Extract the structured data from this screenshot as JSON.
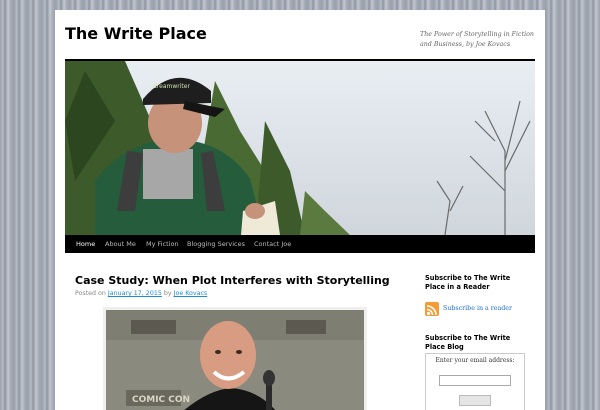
{
  "site": {
    "title": "The Write Place",
    "description": "The Power of Storytelling in Fiction and Business, by Joe Kovacs"
  },
  "nav": {
    "items": [
      {
        "label": "Home",
        "active": true
      },
      {
        "label": "About Me",
        "active": false
      },
      {
        "label": "My Fiction",
        "active": false
      },
      {
        "label": "Blogging Services",
        "active": false
      },
      {
        "label": "Contact Joe",
        "active": false
      }
    ]
  },
  "banner": {
    "cap_text": "dreamwriter"
  },
  "post": {
    "title": "Case Study: When Plot Interferes with Storytelling",
    "meta_prefix": "Posted on",
    "date": "January 17, 2015",
    "by": "by",
    "author": "Joe Kovacs",
    "image_text": "COMIC CON"
  },
  "sidebar": {
    "reader_heading": "Subscribe to The Write Place in a Reader",
    "reader_link": "Subscribe in a reader",
    "blog_heading": "Subscribe to The Write Place Blog",
    "email_label": "Enter your email address:",
    "email_value": ""
  },
  "colors": {
    "accent_link": "#1b8be0",
    "nav_bg": "#000000",
    "rss": "#f49c33"
  }
}
